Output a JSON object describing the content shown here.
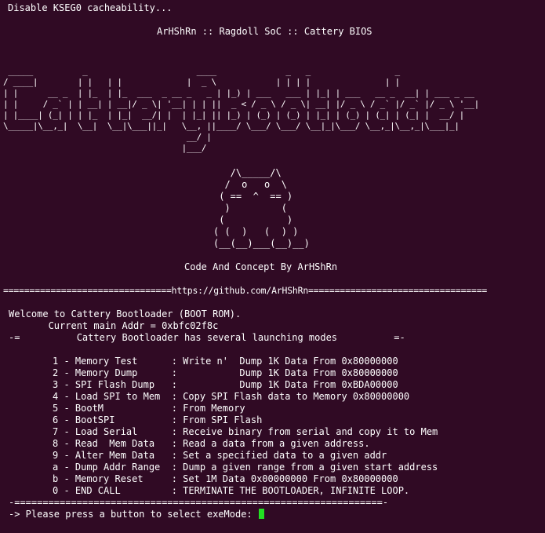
{
  "header": {
    "status_line": "Disable KSEG0 cacheability...",
    "title": "ArHShRn :: Ragdoll SoC :: Cattery BIOS"
  },
  "banner": {
    "logo_text": "CatteryBootloader",
    "logo_ascii": " _____          _                      ____              _   _                 _\n/ ____|        | |   | |             |  _ \\            | | | |               | |\n| |      __ _  | |_  | |_  ___  _ __ _   _ | |_) | ___   ___ | |_| | ___   __ _  __| | ___ _ __\n| |     / _` | | __| | __|/ _ \\| '__| | | ||  _ < / _ \\ / _ \\| __| |/ _ \\ / _` |/ _` |/ _ \\ '__|\n| |____| (_| | | |_  | |_|  __/| |  | |_| || |_) | (_) | (_) | |_| | (_) | (_| | (_| |  __/ |\n\\_____|\\__,_|  \\__|  \\__|\\___||_|   \\__, ||____/ \\___/ \\___/ \\__|_|\\___/ \\__,_|\\__,_|\\___|_|\n                                     __/ |\n                                    |___/",
    "cat_ascii": "   /\\_____/\\\n  /  o   o  \\\n ( ==  ^  == )\n  )         (\n (           )\n( (  )   (  ) )\n(__(__)___(__)__)",
    "credit": "Code And Concept By ArHShRn",
    "rule": "================================https://github.com/ArHShRn=================================="
  },
  "welcome": {
    "line1": "Welcome to Cattery Bootloader (BOOT ROM).",
    "line2": "       Current main Addr = 0xbfc02f8c",
    "line3": "-=          Cattery Bootloader has several launching modes          =-"
  },
  "menu": {
    "items": [
      "1 - Memory Test      : Write n'  Dump 1K Data From 0x80000000",
      "2 - Memory Dump      :           Dump 1K Data From 0x80000000",
      "3 - SPI Flash Dump   :           Dump 1K Data From 0xBDA00000",
      "4 - Load SPI to Mem  : Copy SPI Flash data to Memory 0x80000000",
      "5 - BootM            : From Memory",
      "6 - BootSPI          : From SPI Flash",
      "7 - Load Serial      : Receive binary from serial and copy it to Mem",
      "8 - Read  Mem Data   : Read a data from a given address.",
      "9 - Alter Mem Data   : Set a specified data to a given addr",
      "a - Dump Addr Range  : Dump a given range from a given start address",
      "b - Memory Reset     : Set 1M Data 0x00000000 From 0x80000000",
      "0 - END CALL         : TERMINATE THE BOOTLOADER, INFINITE LOOP."
    ]
  },
  "footer": {
    "rule": "-=================================================================-",
    "prompt": "-> Please press a button to select exeMode: "
  },
  "colors": {
    "background": "#300a24",
    "foreground": "#ffffff",
    "cursor": "#22e022"
  }
}
